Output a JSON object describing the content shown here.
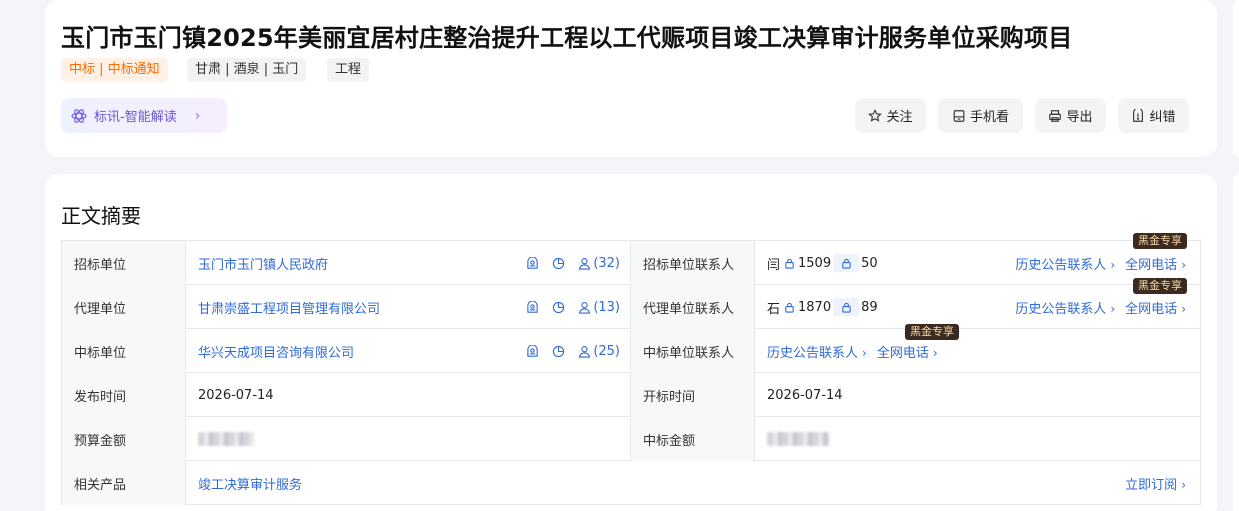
{
  "header": {
    "title": "玉门市玉门镇2025年美丽宜居村庄整治提升工程以工代赈项目竣工决算审计服务单位采购项目",
    "tags": {
      "status": "中标 | 中标通知",
      "region": "甘肃 | 酒泉 | 玉门",
      "type": "工程"
    },
    "ai_button": "标讯-智能解读",
    "actions": {
      "follow": "关注",
      "mobile": "手机看",
      "export": "导出",
      "report": "纠错"
    }
  },
  "summary": {
    "section_title": "正文摘要",
    "labels": {
      "tenderer": "招标单位",
      "tenderer_contact": "招标单位联系人",
      "agent": "代理单位",
      "agent_contact": "代理单位联系人",
      "winner": "中标单位",
      "winner_contact": "中标单位联系人",
      "publish_time": "发布时间",
      "open_time": "开标时间",
      "budget": "预算金额",
      "win_amount": "中标金额",
      "related": "相关产品"
    },
    "tenderer": {
      "name": "玉门市玉门镇人民政府",
      "count": "(32)"
    },
    "tenderer_contact": {
      "surname": "闫",
      "phone_a": "1509",
      "phone_b": "50"
    },
    "agent": {
      "name": "甘肃崇盛工程项目管理有限公司",
      "count": "(13)"
    },
    "agent_contact": {
      "surname": "石",
      "phone_a": "1870",
      "phone_b": "89"
    },
    "winner": {
      "name": "华兴天成项目咨询有限公司",
      "count": "(25)"
    },
    "publish_time": "2026-07-14",
    "open_time": "2026-07-14",
    "related_product": "竣工决算审计服务",
    "links": {
      "history_contacts": "历史公告联系人",
      "all_phone": "全网电话",
      "subscribe": "立即订阅"
    },
    "vip_badge": "黑金专享"
  },
  "colors": {
    "link": "#2f6bd8",
    "status_tag": "#ff6a00",
    "badge_bg": "#3a2a1f",
    "badge_text": "#f6d8a8"
  }
}
